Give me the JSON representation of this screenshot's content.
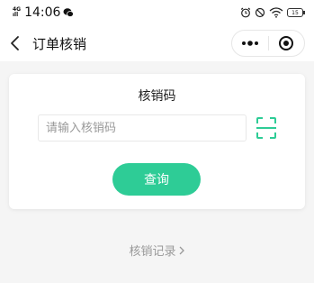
{
  "status_bar": {
    "signal_top": "4G",
    "signal_bottom": "ıll",
    "time": "14:06",
    "battery": "15"
  },
  "nav": {
    "title": "订单核销"
  },
  "card": {
    "title": "核销码",
    "input_value": "",
    "input_placeholder": "请输入核销码",
    "query_label": "查询"
  },
  "footer": {
    "records_label": "核销记录"
  },
  "colors": {
    "accent": "#2ecc96",
    "scan_icon": "#2ecc96"
  }
}
